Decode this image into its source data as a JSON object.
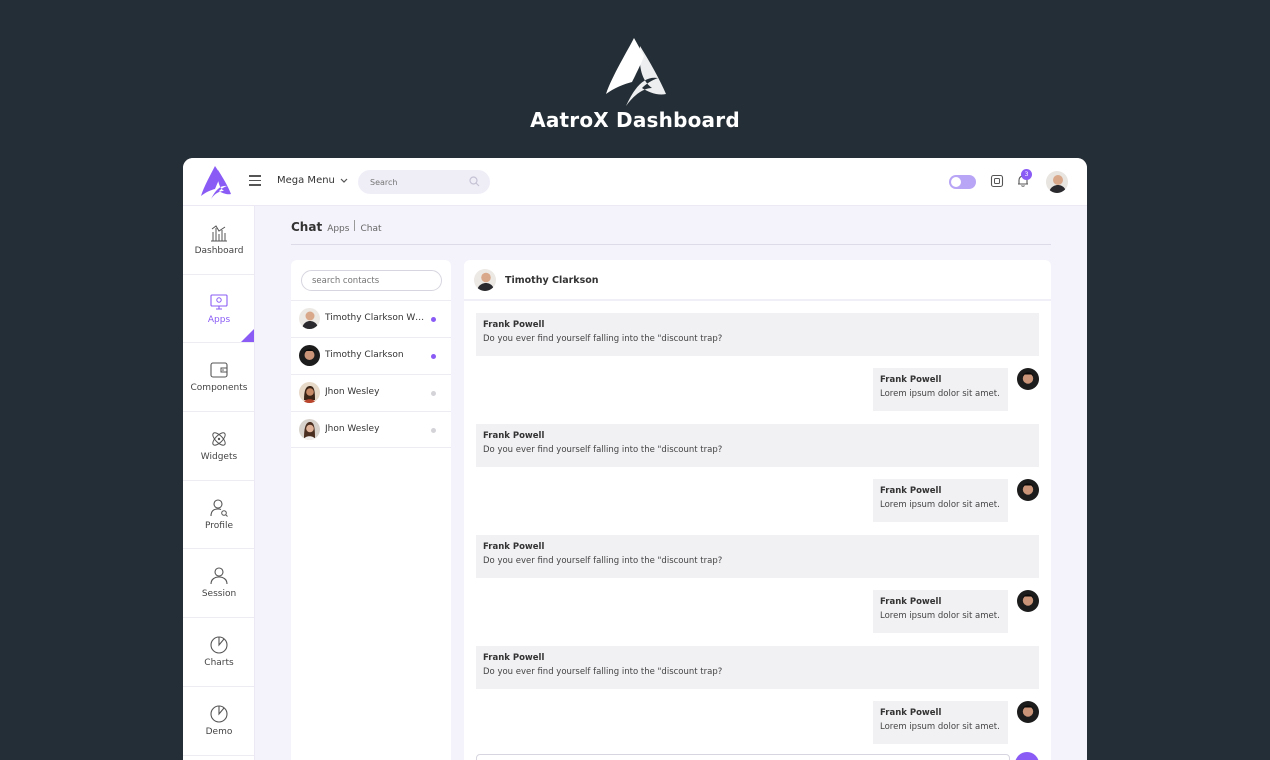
{
  "hero": {
    "title": "AatroX Dashboard"
  },
  "topbar": {
    "menu_label": "Mega Menu",
    "search_placeholder": "Search",
    "notification_count": "3",
    "accent": "#8a5cf5"
  },
  "sidebar": {
    "items": [
      {
        "label": "Dashboard",
        "icon": "bar-chart-icon",
        "active": false
      },
      {
        "label": "Apps",
        "icon": "monitor-icon",
        "active": true
      },
      {
        "label": "Components",
        "icon": "wallet-icon",
        "active": false
      },
      {
        "label": "Widgets",
        "icon": "atom-icon",
        "active": false
      },
      {
        "label": "Profile",
        "icon": "user-search-icon",
        "active": false
      },
      {
        "label": "Session",
        "icon": "user-icon",
        "active": false
      },
      {
        "label": "Charts",
        "icon": "pie-chart-icon",
        "active": false
      },
      {
        "label": "Demo",
        "icon": "pie-chart-icon",
        "active": false
      }
    ]
  },
  "breadcrumb": {
    "title": "Chat",
    "parent": "Apps",
    "current": "Chat"
  },
  "contacts": {
    "search_placeholder": "search contacts",
    "items": [
      {
        "name": "Timothy Clarkson Wi...",
        "online": true
      },
      {
        "name": "Timothy Clarkson",
        "online": true
      },
      {
        "name": "Jhon Wesley",
        "online": false
      },
      {
        "name": "Jhon Wesley",
        "online": false
      }
    ]
  },
  "chat": {
    "header_name": "Timothy Clarkson",
    "messages": [
      {
        "direction": "in",
        "sender": "Frank Powell",
        "text": "Do you ever find yourself falling into the \"discount trap?"
      },
      {
        "direction": "out",
        "sender": "Frank Powell",
        "text": "Lorem ipsum dolor sit amet."
      },
      {
        "direction": "in",
        "sender": "Frank Powell",
        "text": "Do you ever find yourself falling into the \"discount trap?"
      },
      {
        "direction": "out",
        "sender": "Frank Powell",
        "text": "Lorem ipsum dolor sit amet."
      },
      {
        "direction": "in",
        "sender": "Frank Powell",
        "text": "Do you ever find yourself falling into the \"discount trap?"
      },
      {
        "direction": "out",
        "sender": "Frank Powell",
        "text": "Lorem ipsum dolor sit amet."
      },
      {
        "direction": "in",
        "sender": "Frank Powell",
        "text": "Do you ever find yourself falling into the \"discount trap?"
      },
      {
        "direction": "out",
        "sender": "Frank Powell",
        "text": "Lorem ipsum dolor sit amet."
      }
    ]
  }
}
